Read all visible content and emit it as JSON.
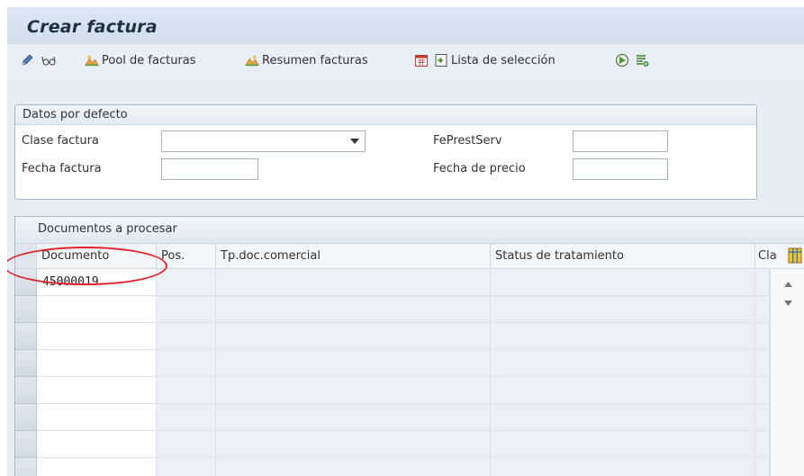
{
  "window": {
    "title": "Crear factura"
  },
  "toolbar": {
    "pool_label": "Pool de facturas",
    "resumen_label": "Resumen facturas",
    "lista_label": "Lista de selección",
    "icons": [
      "pencil-icon",
      "glasses-icon",
      "pool-icon",
      "resumen-icon",
      "calendar-icon",
      "list-select-icon",
      "execute-icon",
      "layout-icon"
    ]
  },
  "defaults_panel": {
    "title": "Datos por defecto",
    "clase_factura_label": "Clase factura",
    "clase_factura_value": "",
    "fecha_factura_label": "Fecha factura",
    "fecha_factura_value": "",
    "feprestserv_label": "FePrestServ",
    "feprestserv_value": "",
    "fecha_precio_label": "Fecha de precio",
    "fecha_precio_value": ""
  },
  "documents_grid": {
    "title": "Documentos a procesar",
    "columns": [
      "Documento",
      "Pos.",
      "Tp.doc.comercial",
      "Status de tratamiento",
      "Cla"
    ],
    "rows": [
      [
        "45000019",
        "",
        "",
        "",
        ""
      ],
      [
        "",
        "",
        "",
        "",
        ""
      ],
      [
        "",
        "",
        "",
        "",
        ""
      ],
      [
        "",
        "",
        "",
        "",
        ""
      ],
      [
        "",
        "",
        "",
        "",
        ""
      ],
      [
        "",
        "",
        "",
        "",
        ""
      ],
      [
        "",
        "",
        "",
        "",
        ""
      ],
      [
        "",
        "",
        "",
        "",
        ""
      ]
    ]
  },
  "colors": {
    "accent": "#e0242a",
    "frame_bg": "#e7edf4",
    "header_bg": "#dce6f2",
    "title_text": "#1f2f44"
  }
}
